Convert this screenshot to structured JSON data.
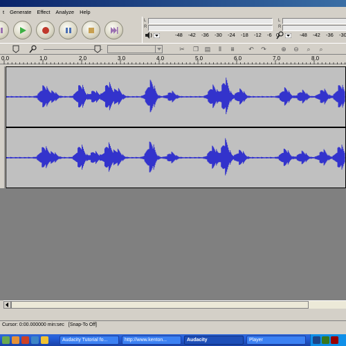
{
  "menubar": {
    "items": [
      "t",
      "Generate",
      "Effect",
      "Analyze",
      "Help"
    ]
  },
  "meter": {
    "scale_top_left": [
      "-48",
      "-42",
      "-36",
      "-30",
      "-24",
      "-18",
      "-12",
      "-6",
      "0"
    ],
    "scale_top_right": [
      "-48",
      "-42",
      "-36",
      "-30"
    ],
    "l_label": "L",
    "r_label": "R"
  },
  "ruler": {
    "labels": [
      "0.0",
      "1.0",
      "2.0",
      "3.0",
      "4.0",
      "5.0",
      "6.0",
      "7.0",
      "8.0"
    ]
  },
  "status": {
    "cursor": "Cursor: 0:00.000000 min:sec",
    "snap": "[Snap-To Off]"
  },
  "taskbar": {
    "tasks": [
      "Audacity Tutorial fo...",
      "http://www.kenton...",
      "Audacity",
      "Player"
    ]
  },
  "colors": {
    "waveform": "#3333cc",
    "track_bg": "#c0c0c0",
    "workspace": "#808080"
  },
  "icons": {
    "transport": [
      "pause-icon",
      "play-icon",
      "record-icon",
      "pause-icon",
      "stop-icon",
      "skip-end-icon"
    ]
  }
}
